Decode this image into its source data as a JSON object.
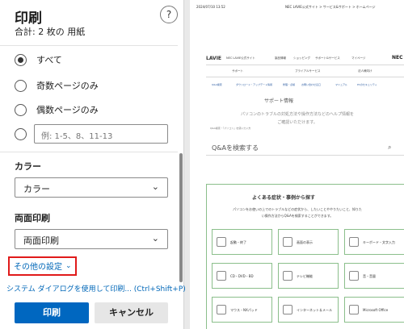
{
  "panel": {
    "title": "印刷",
    "subtitle": "合計: 2 枚の 用紙",
    "help_icon": "?",
    "pages": {
      "options": [
        "すべて",
        "奇数ページのみ",
        "偶数ページのみ"
      ],
      "selected": "すべて",
      "custom_placeholder": "例: 1-5、8、11-13"
    },
    "color": {
      "label": "カラー",
      "value": "カラー"
    },
    "duplex": {
      "label": "両面印刷",
      "value": "両面印刷"
    },
    "more_settings": "その他の設定",
    "system_dialog": "システム ダイアログを使用して印刷... (Ctrl+Shift+P)",
    "buttons": {
      "print": "印刷",
      "cancel": "キャンセル"
    }
  },
  "preview": {
    "timestamp": "2024/07/10 13:52",
    "page_title": "NEC LAVIE公式サイト > サービス&サポート > ホームページ",
    "logo": "LAVIE",
    "nav": [
      "NEC LAVIE公式サイト",
      "製品情報",
      "ショッピング",
      "サポート&サービス",
      "マイページ"
    ],
    "brand": "NEC",
    "subnav": [
      "サポート",
      "ブライアルサービス",
      "法人様向け"
    ],
    "links": [
      "Q&A検索",
      "ダウンロード・アップデート情報",
      "修理・点検",
      "お問い合わせ窓口",
      "マニュアル",
      "PCのセキュリティ"
    ],
    "support_title": "サポート情報",
    "support_desc": "パソコンのトラブルの対処方法や操作方法などのヘルプ情報をご確認いただけます。",
    "qa_small": "Q&A検索・「パソコン」を使いたい方",
    "qa_title": "Q&Aを検索する",
    "box_title": "よくある症状・事例から探す",
    "box_desc": "パソコンをお使いの上でのトラブルなどの症状から、したいことややりたいこと、知りたい操作方法からQ&Aを検索することができます。",
    "tiles": [
      "起動・終了",
      "画面の表示",
      "キーボード・文字入力",
      "CD・DVD・BD",
      "テレビ機能",
      "音・音量",
      "マウス・NXパッド",
      "インターネット＆メール",
      "Microsoft Office"
    ]
  }
}
